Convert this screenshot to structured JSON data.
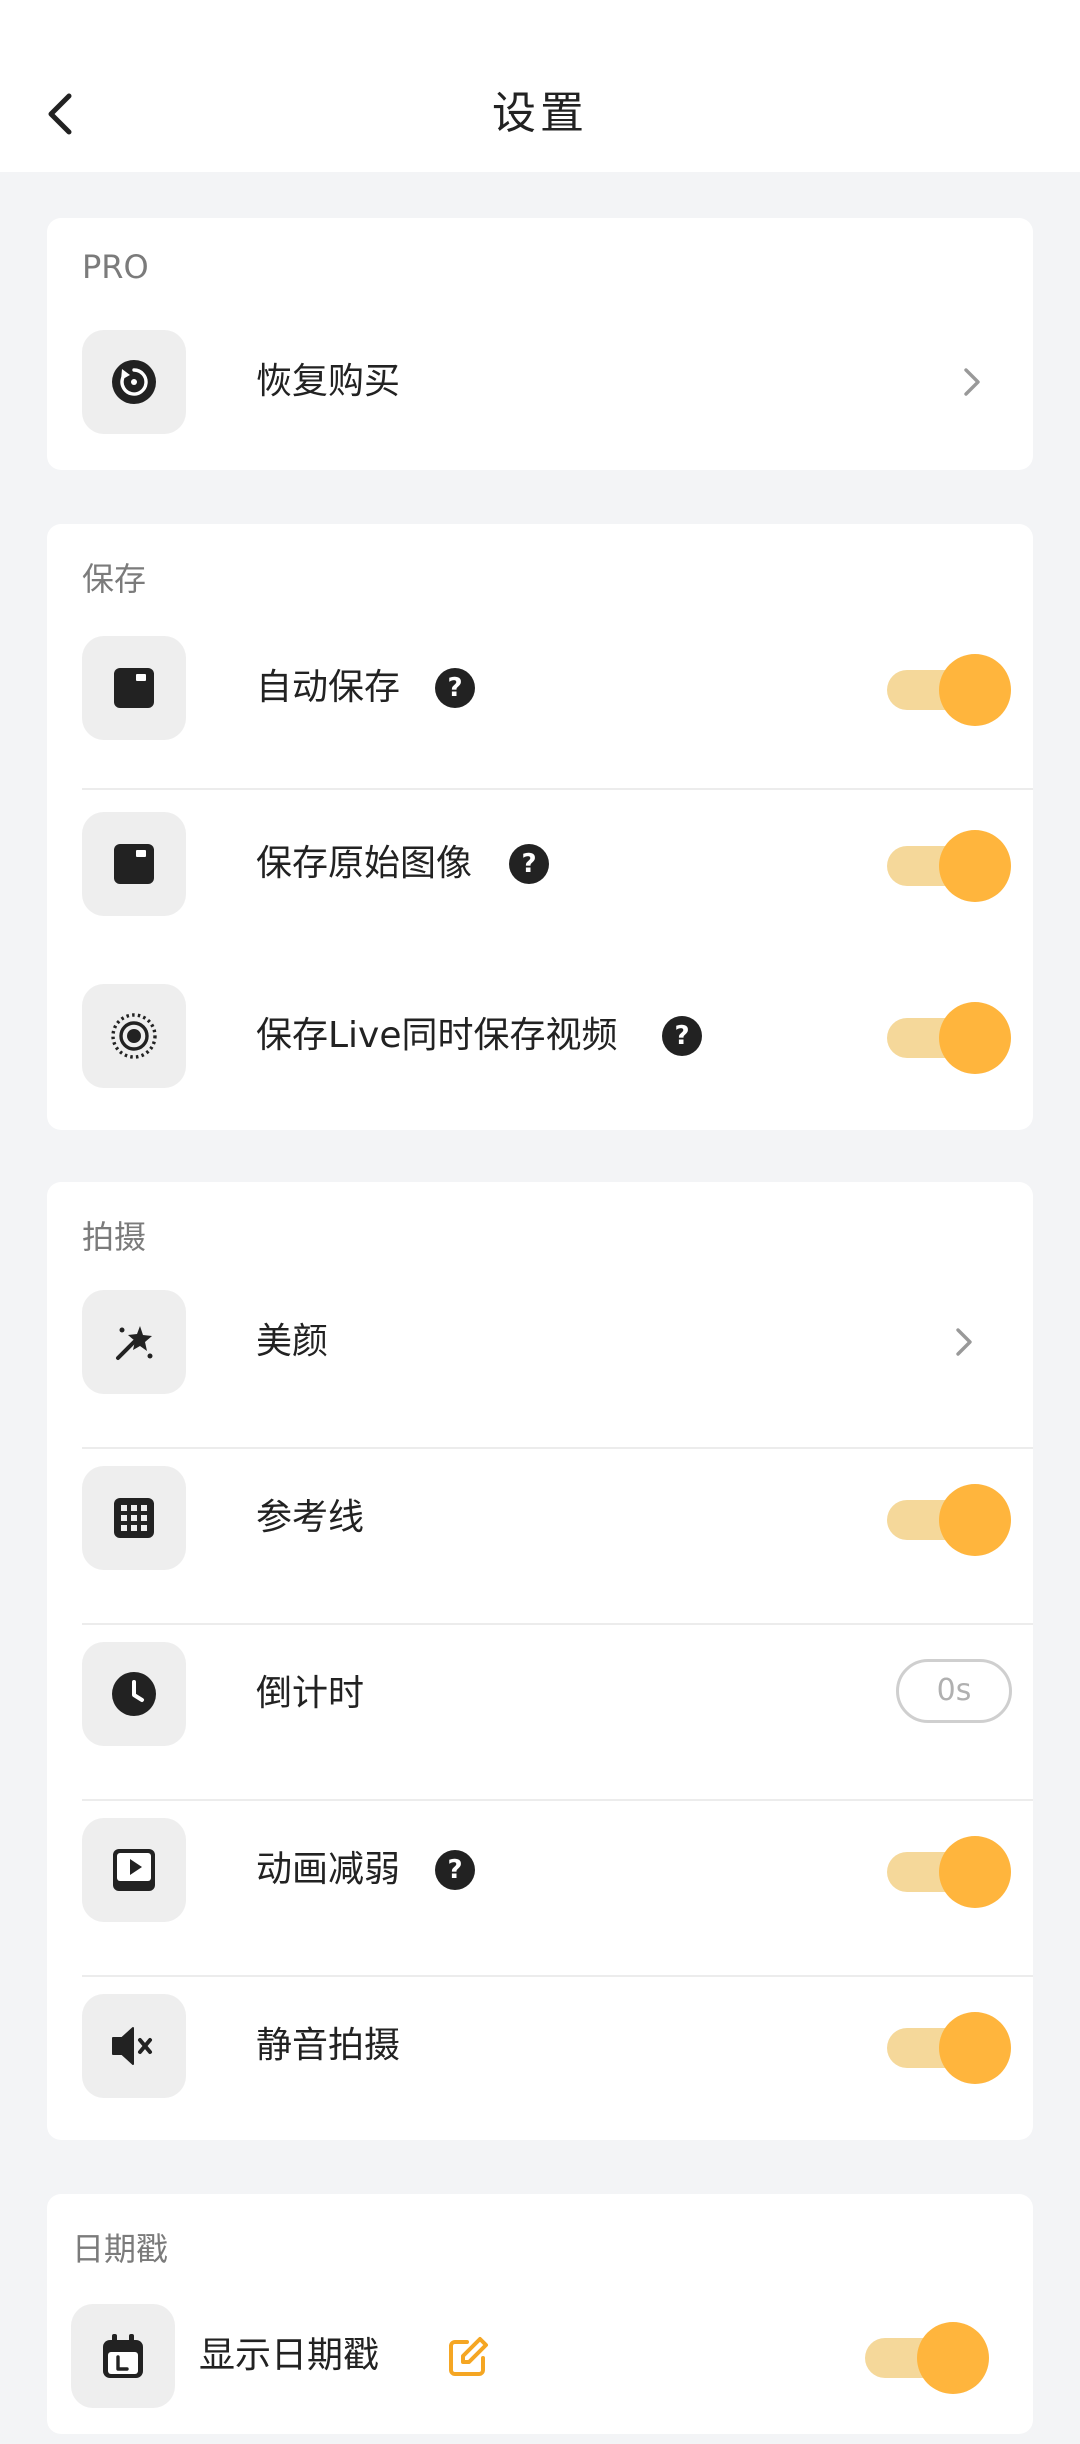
{
  "header": {
    "title": "设置"
  },
  "sections": {
    "pro": {
      "title": "PRO",
      "restore": {
        "label": "恢复购买"
      }
    },
    "save": {
      "title": "保存",
      "autosave": {
        "label": "自动保存",
        "enabled": true
      },
      "original": {
        "label": "保存原始图像",
        "enabled": true
      },
      "live": {
        "label": "保存Live同时保存视频",
        "enabled": true
      }
    },
    "shoot": {
      "title": "拍摄",
      "beauty": {
        "label": "美颜"
      },
      "grid": {
        "label": "参考线",
        "enabled": true
      },
      "timer": {
        "label": "倒计时",
        "value": "0s"
      },
      "reduce_motion": {
        "label": "动画减弱",
        "enabled": true
      },
      "silent": {
        "label": "静音拍摄",
        "enabled": true
      }
    },
    "datestamp": {
      "title": "日期戳",
      "show": {
        "label": "显示日期戳",
        "enabled": true
      }
    }
  },
  "help_glyph": "?",
  "colors": {
    "accent": "#ffb53d",
    "track": "#f5d89a",
    "background": "#f3f4f6",
    "edit_icon": "#f5a623"
  }
}
